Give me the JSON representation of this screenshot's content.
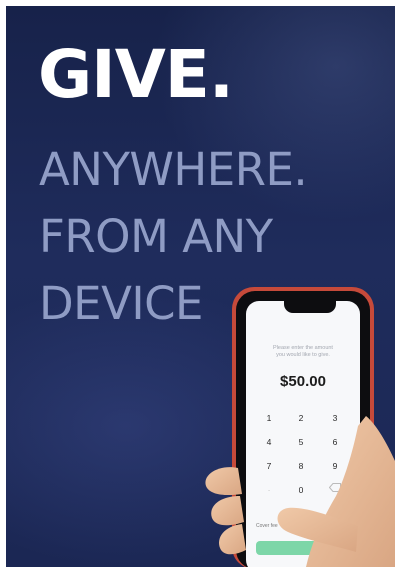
{
  "headline": "GIVE.",
  "tagline": [
    "ANYWHERE.",
    "FROM ANY",
    "DEVICE"
  ],
  "phone": {
    "prompt": [
      "Please enter the amount",
      "you would like to give."
    ],
    "amount": "$50.00",
    "keys": [
      [
        "1",
        "2",
        "3"
      ],
      [
        "4",
        "5",
        "6"
      ],
      [
        "7",
        "8",
        "9"
      ],
      [
        "",
        "0",
        ""
      ]
    ],
    "cover_fees_label": "Cover fee"
  },
  "colors": {
    "background": "#1f2c5c",
    "headline": "#ffffff",
    "tagline": "#8f9cc4",
    "phone_case": "#c64a3a",
    "give_button": "#7dd6a8"
  }
}
